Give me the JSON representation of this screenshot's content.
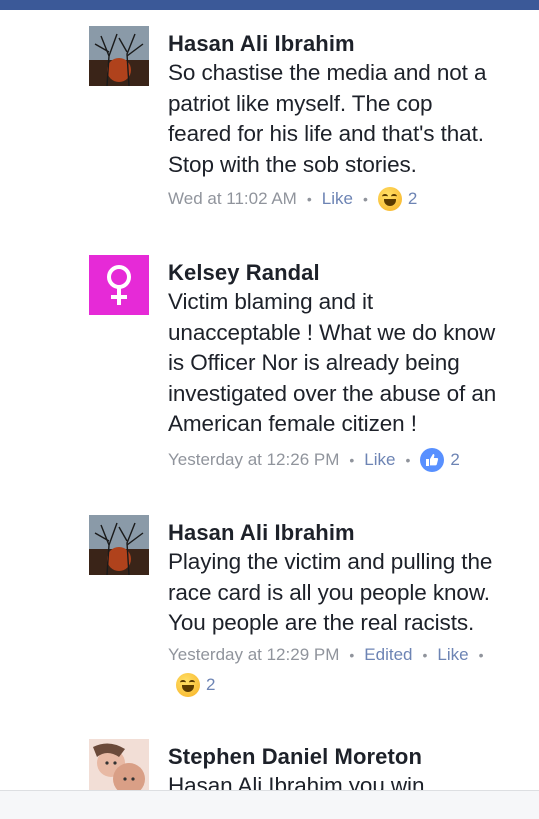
{
  "comments": [
    {
      "author": "Hasan Ali Ibrahim",
      "text": "So chastise the media and not a\npatriot like myself. The cop\nfeared for his life and that's that.\nStop with the sob stories.",
      "time": "Wed at 11:02 AM",
      "like_label": "Like",
      "reaction_icon": "haha-emoji",
      "reaction_count": "2"
    },
    {
      "author": "Kelsey Randal",
      "avatar_symbol": "♀",
      "avatar_color": "#e62ad7",
      "text": "Victim blaming and it\nunacceptable ! What we do know\nis Officer Nor is already being\ninvestigated over the abuse of an\nAmerican  female citizen !",
      "time": "Yesterday at 12:26 PM",
      "like_label": "Like",
      "reaction_icon": "like-thumb",
      "reaction_count": "2"
    },
    {
      "author": "Hasan Ali Ibrahim",
      "text": "Playing the victim and pulling the\nrace card is all you people know.\nYou people are the real racists.",
      "time": "Yesterday at 12:29 PM",
      "edited_label": "Edited",
      "like_label": "Like",
      "reaction_icon": "haha-emoji",
      "reaction_count": "2"
    },
    {
      "author": "Stephen Daniel Moreton",
      "text": "Hasan Ali Ibrahim  you win"
    }
  ],
  "colors": {
    "link": "#6d84b4",
    "meta": "#90949c",
    "topbar": "#3b5998"
  }
}
